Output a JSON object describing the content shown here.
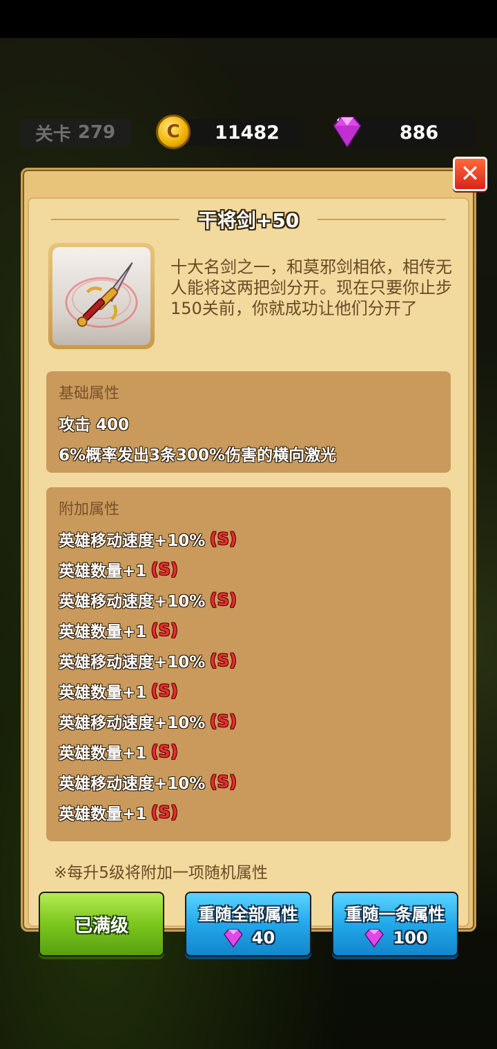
{
  "hud": {
    "level_label": "关卡",
    "level_value": "279",
    "coin_symbol": "C",
    "coins": "11482",
    "gems": "886"
  },
  "modal": {
    "close_label": "✕",
    "title": "干将剑+50",
    "description": "十大名剑之一，和莫邪剑相依，相传无人能将这两把剑分开。现在只要你止步150关前，你就成功让他们分开了",
    "base_section": {
      "title": "基础属性",
      "stats": [
        "攻击 400",
        "6%概率发出3条300%伤害的横向激光"
      ]
    },
    "extra_section": {
      "title": "附加属性",
      "stats": [
        {
          "text": "英雄移动速度+10%",
          "grade": "S"
        },
        {
          "text": "英雄数量+1",
          "grade": "S"
        },
        {
          "text": "英雄移动速度+10%",
          "grade": "S"
        },
        {
          "text": "英雄数量+1",
          "grade": "S"
        },
        {
          "text": "英雄移动速度+10%",
          "grade": "S"
        },
        {
          "text": "英雄数量+1",
          "grade": "S"
        },
        {
          "text": "英雄移动速度+10%",
          "grade": "S"
        },
        {
          "text": "英雄数量+1",
          "grade": "S"
        },
        {
          "text": "英雄移动速度+10%",
          "grade": "S"
        },
        {
          "text": "英雄数量+1",
          "grade": "S"
        }
      ]
    },
    "note": "※每升5级将附加一项随机属性"
  },
  "buttons": {
    "max_level": "已满级",
    "reroll_all": {
      "label": "重随全部属性",
      "cost": "40"
    },
    "reroll_one": {
      "label": "重随一条属性",
      "cost": "100"
    }
  },
  "colors": {
    "grade_s": "#e23030",
    "panel": "#f2d99e",
    "section": "#c99a5c"
  }
}
